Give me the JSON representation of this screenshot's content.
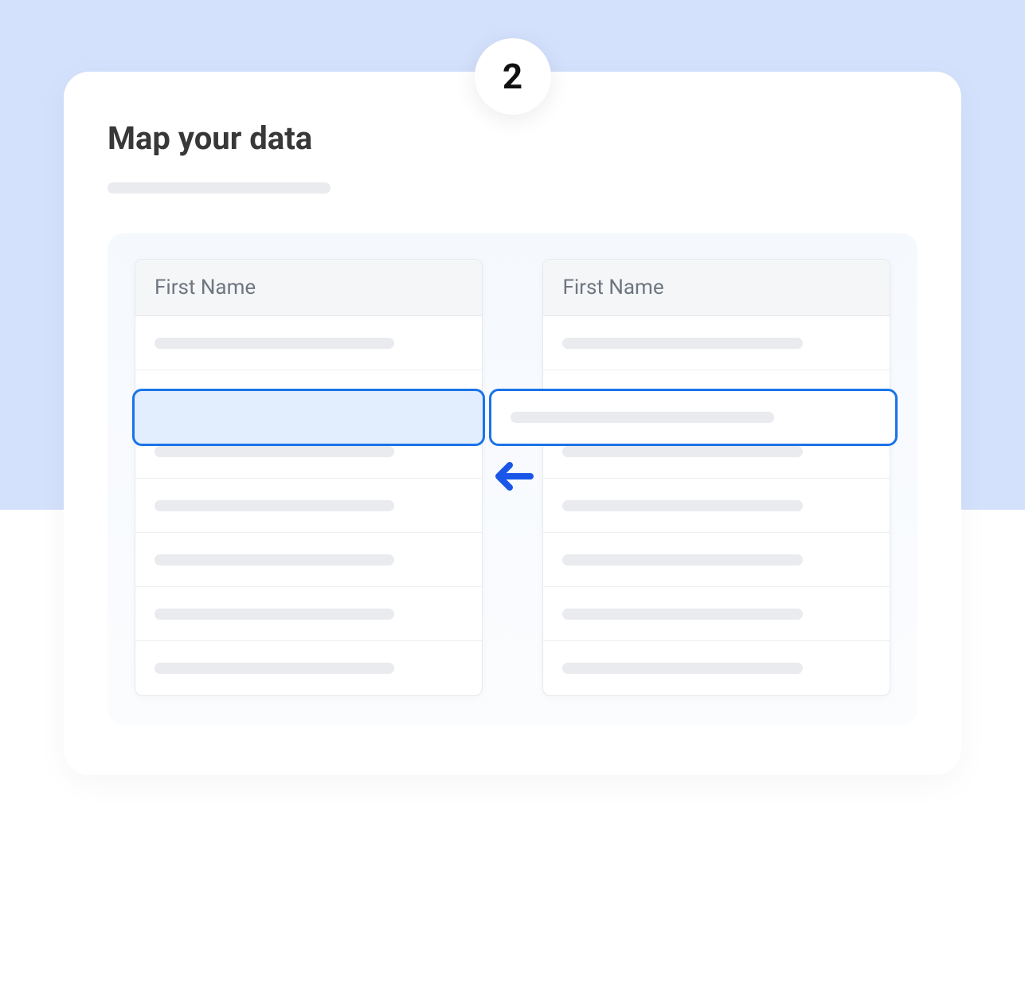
{
  "step": {
    "number": "2"
  },
  "title": "Map your data",
  "leftColumn": {
    "header": "First Name"
  },
  "rightColumn": {
    "header": "First Name"
  },
  "colors": {
    "accent": "#1A73E8",
    "backgroundBlue": "#D3E1FC"
  }
}
